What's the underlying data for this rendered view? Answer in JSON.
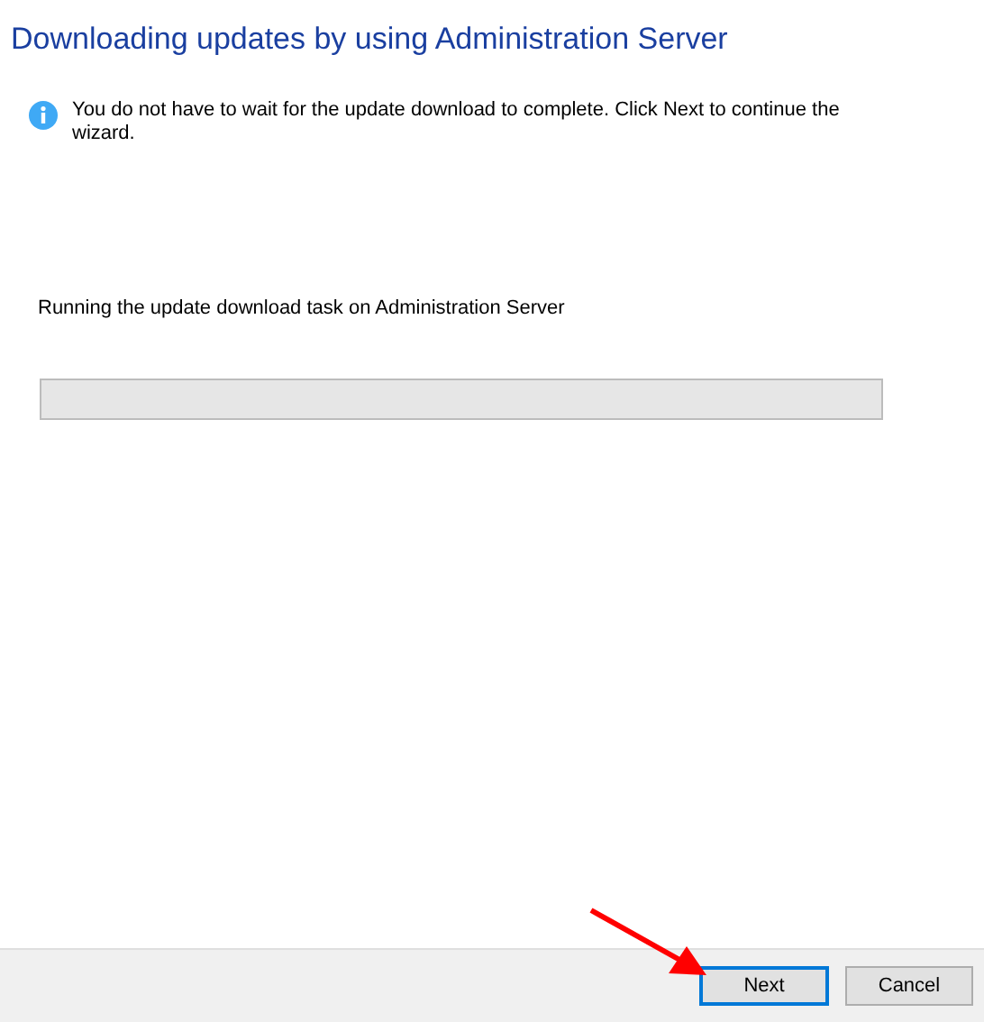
{
  "title": "Downloading updates by using Administration Server",
  "info": {
    "text": "You do not have to wait for the update download to complete. Click Next to continue the wizard."
  },
  "task_label": "Running the update download task on Administration Server",
  "progress": {
    "level": 0
  },
  "buttons": [
    {
      "label": "Next",
      "default": true
    },
    {
      "label": "Cancel",
      "default": false
    }
  ],
  "annotation": {
    "kind": "arrow"
  }
}
